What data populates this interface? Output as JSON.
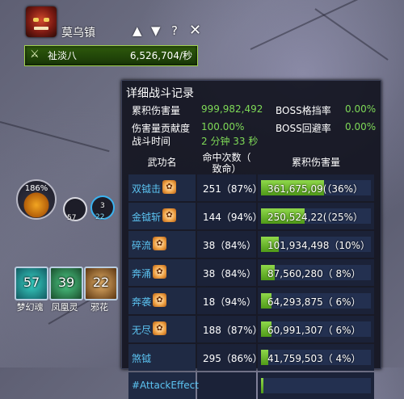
{
  "top_widget": {
    "map_name": "莫乌镇",
    "player_name": "祉淡八",
    "dps_value": "6,526,704/秒",
    "icons": [
      "boss-avatar",
      "up-arrow-icon",
      "dropdown-icon",
      "help-icon",
      "close-icon"
    ]
  },
  "combat_log": {
    "title": "详细战斗记录",
    "summary": [
      {
        "label": "累积伤害量",
        "value": "999,982,492",
        "label2": "BOSS格挡率",
        "value2": "0.00%"
      },
      {
        "label": "伤害量贡献度",
        "value": "100.00%",
        "label2": "BOSS回避率",
        "value2": "0.00%"
      },
      {
        "label": "战斗时间",
        "value": "2 分钟 33 秒"
      }
    ],
    "headers": {
      "skill": "武功名",
      "hits_line1": "命中次数（",
      "hits_line2": "致命）",
      "damage": "累积伤害量"
    },
    "rows": [
      {
        "skill": "双钺击",
        "hits": "251（87%）",
        "damage": "361,675,09(（36%）",
        "bar_fraction": 0.36
      },
      {
        "skill": "金钺斩",
        "hits": "144（94%）",
        "damage": "250,524,22(（25%）",
        "bar_fraction": 0.25
      },
      {
        "skill": "碎流",
        "hits": "38（84%）",
        "damage": "101,934,498（10%）",
        "bar_fraction": 0.1
      },
      {
        "skill": "奔涌",
        "hits": "38（84%）",
        "damage": "87,560,280（ 8%）",
        "bar_fraction": 0.08
      },
      {
        "skill": "奔袭",
        "hits": "18（94%）",
        "damage": "64,293,875（ 6%）",
        "bar_fraction": 0.06
      },
      {
        "skill": "无尽",
        "hits": "188（87%）",
        "damage": "60,991,307（ 6%）",
        "bar_fraction": 0.06
      },
      {
        "skill": "煞钺",
        "hits": "295（86%）",
        "damage": "41,759,503（ 4%）",
        "bar_fraction": 0.04
      },
      {
        "skill": "#AttackEffect",
        "hits": "",
        "damage": "",
        "bar_fraction": 0.0
      }
    ]
  },
  "hud": {
    "combo_percent": "186%",
    "mini_dial_1": "57",
    "mini_dial_2_top": "3",
    "mini_dial_2_bottom": "22",
    "skills": [
      {
        "number": "57",
        "label": "梦幻魂",
        "color": "#1e8f8f"
      },
      {
        "number": "39",
        "label": "凤凰灵",
        "color": "#1f6d40"
      },
      {
        "number": "22",
        "label": "邪花",
        "color": "#8a5a22"
      }
    ]
  }
}
